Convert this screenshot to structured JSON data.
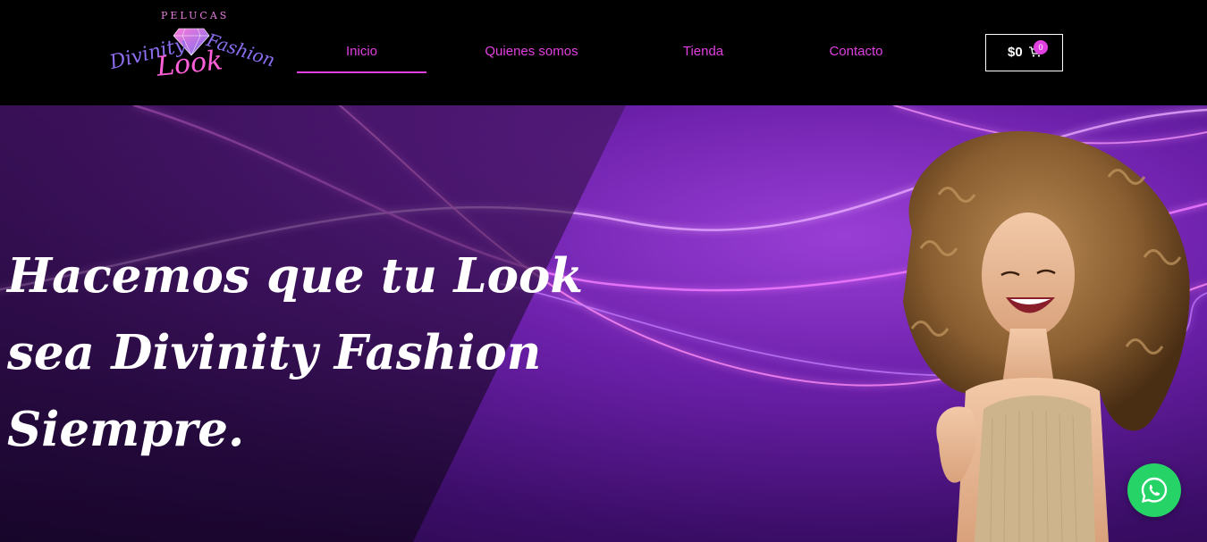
{
  "logo": {
    "top_word": "PELUCAS",
    "word_left": "Divinity",
    "word_center": "Look",
    "word_right": "Fashion"
  },
  "nav": {
    "items": [
      {
        "label": "Inicio",
        "active": true
      },
      {
        "label": "Quienes somos",
        "active": false
      },
      {
        "label": "Tienda",
        "active": false
      },
      {
        "label": "Contacto",
        "active": false
      }
    ]
  },
  "cart": {
    "total": "$0",
    "count": "0",
    "icon": "cart-icon"
  },
  "hero": {
    "headline": [
      "Hacemos que tu Look",
      "sea Divinity Fashion",
      "Siempre."
    ]
  },
  "floating": {
    "icon": "whatsapp-icon"
  },
  "colors": {
    "accent": "#e040e0",
    "header_bg": "#000000",
    "whatsapp": "#25d366"
  }
}
